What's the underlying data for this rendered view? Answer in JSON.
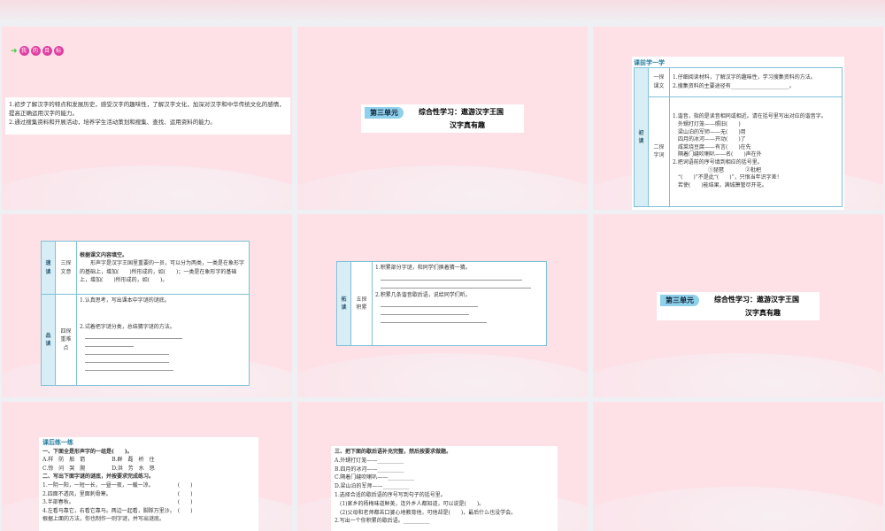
{
  "slide1": {
    "goal_chars": [
      "我",
      "的",
      "目",
      "标"
    ],
    "lines": [
      "1.初步了解汉字的特点和发展历史，感受汉字的趣味性，了解汉字文化，加深对汉字和中华传统文化的感情，提高正确运用汉字的能力。",
      "2.通过搜集资料和开展活动，培养学生活动策划和搜集、查找、运用资料的能力。"
    ]
  },
  "title": {
    "unit": "第三单元",
    "line1": "综合性学习：遨游汉字王国",
    "line2": "汉字真有趣"
  },
  "slide3": {
    "header": "课前学一学",
    "col_main": "初读",
    "r1_label": "一探课文",
    "r1_lines": [
      "1.仔细阅读材料，了解汉字的趣味性，学习搜集资料的方法。",
      "2.搜集资料的主要途径有______________________。"
    ],
    "r2_label": "二探字词",
    "r2_lines": [
      "1.谐音，指的是读音相同或相近。请在括号里写出对应的谐音字。",
      "外甥打灯笼——照旧(　　)",
      "梁山泊的军师——无(　　)用",
      "四月的冰河——开动(　　)了",
      "咸菜烧豆腐——有言(　　)在先",
      "隔着门缝吹喇叭——名(　　)声在外",
      "2.把词语前的序号填到相应的括号里。",
      "①琵琶　　　　②枇杷",
      "“(　　)”不是此“(　　)”，只恨当年识字差！",
      "若使(　　)能结果，满城箫管尽开花。"
    ]
  },
  "slide4": {
    "r1_main": "速读",
    "r1_label": "三探文意",
    "r1_title": "根据课文内容填空。",
    "r1_text": "形声字是汉字王国里重要的一员，可以分为两类，一类是在象形字的基础上，增加(　　)所形成的，如(　　)；一类是在象形字的基础上，增加(　　)所形成的，如(　　)。",
    "r2_main": "品读",
    "r2_label": "四探重难点",
    "r2_q1": "1.认真思考，写出课本中字谜的谜底。",
    "r2_q2": "2.试着把字谜分类，总结猜字谜的方法。"
  },
  "slide5": {
    "main": "拓读",
    "label": "五探积累",
    "q1": "1.积累部分字谜，和同学们换着猜一猜。",
    "q2": "2.积累几条谐音歇后语，说给同学们听。"
  },
  "slide7": {
    "header": "课后练一练",
    "lines": [
      "一、下面全是形声字的一组是(　　)。",
      "A.样　防　舶　箭　　　　　B.群　磊　桥　住",
      "C.惊　问　哭　腕　　　　　D.洪　芳　水　怒",
      "二、写出下面字谜的谜底，并按要求完成练习。",
      "1.一阴一阳，一短一长，一昼一夜，一暖一凉。　　　　　(　　)",
      "2.四面不透风，里面刺骨寒。　　　　　　　　　　　　　(　　)",
      "3.半部春秋。　　　　　　　　　　　　　　　　　　　　(　　)",
      "4.左看马靠它，右看它靠马。两边一起看，脚踩万里沙。　(　　)",
      "根据上面的方法，你也制作一则字谜，并写出谜底。"
    ]
  },
  "slide8": {
    "lines": [
      "三、把下面的歇后语补充完整，然后按要求做题。",
      "A.外甥打灯笼——__________",
      "B.四月的冰河——__________",
      "C.隔着门缝吹喇叭——__________",
      "D.梁山泊的军师——__________",
      "1.选择合适的歇后语的序号写到句子的括号里。",
      "(1)家乡的杨梅味道鲜美，连外乡人都知道，可以说是(　　)。",
      "(2)父母和老师都苦口婆心地教育他，可他却是(　　)，最后什么也没学会。",
      "2.写出一个你积累的歇后语。__________"
    ]
  }
}
